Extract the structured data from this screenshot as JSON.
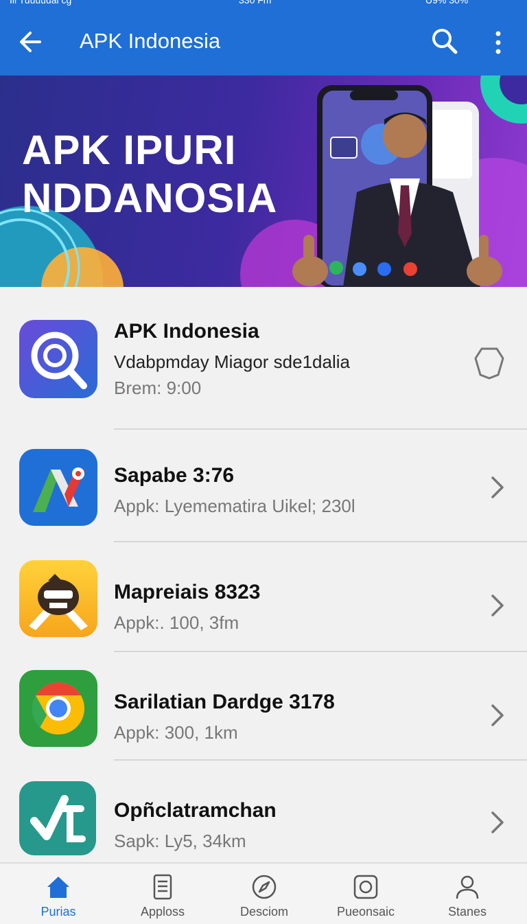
{
  "status_bar": {
    "left": "Ill Tuuuuual cg",
    "time": "330 Fm",
    "battery": "U9% 30%"
  },
  "app_bar": {
    "title": "APK Indonesia",
    "back_icon": "arrow-left-icon",
    "search_icon": "search-icon",
    "menu_icon": "more-vertical-icon"
  },
  "banner": {
    "line1": "APK IPURI",
    "line2": "NDDANOSIA"
  },
  "items": [
    {
      "name": "APK Indonesia",
      "line1": "Vdabpmday Miagor sde1dalia",
      "line2": "Brem: 9:00",
      "trailing": "shield-icon"
    },
    {
      "name": "Sapabe 3:76",
      "line1": "Appk: Lyemematira Uikel; 230l",
      "trailing": "chevron-right-icon"
    },
    {
      "name": "Mapreiais 8323",
      "line1": "Appk:. 100, 3fm",
      "trailing": "chevron-right-icon"
    },
    {
      "name": "Sarilatian Dardge 3178",
      "line1": "Appk: 300, 1km",
      "trailing": "chevron-right-icon"
    },
    {
      "name": "Opñclatramchan",
      "line1": "Sapk: Ly5, 34km",
      "trailing": "chevron-right-icon"
    }
  ],
  "bottom_nav": [
    {
      "label": "Purias",
      "icon": "home-icon",
      "active": true
    },
    {
      "label": "Apploss",
      "icon": "document-icon",
      "active": false
    },
    {
      "label": "Desciom",
      "icon": "compass-icon",
      "active": false
    },
    {
      "label": "Pueonsaic",
      "icon": "camera-square-icon",
      "active": false
    },
    {
      "label": "Stanes",
      "icon": "person-icon",
      "active": false
    }
  ],
  "colors": {
    "primary": "#1f6fd6",
    "background": "#f1f1f1"
  }
}
